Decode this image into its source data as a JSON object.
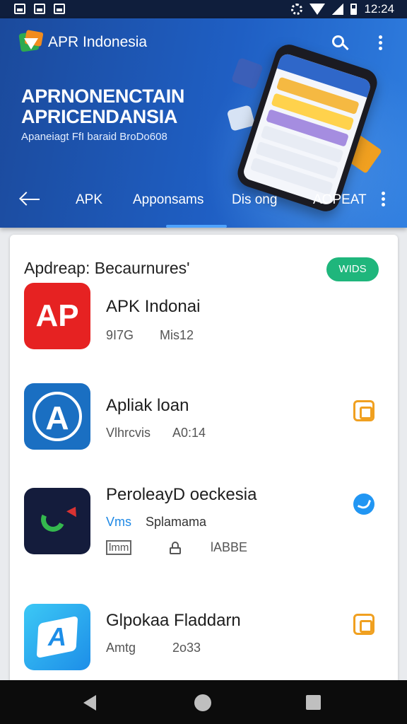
{
  "status_bar": {
    "time": "12:24"
  },
  "header": {
    "app_title": "APR Indonesia",
    "headline_line1": "APRNONENCTAIN",
    "headline_line2": "APRICENDANSIA",
    "subtitle": "Apaneiagt FfI baraid BroDo608"
  },
  "tabs": [
    {
      "label": "APK"
    },
    {
      "label": "Apponsams",
      "active": true
    },
    {
      "label": "Dis ong"
    },
    {
      "label": "AOPEAT"
    }
  ],
  "section": {
    "title": "Apdreap: Becaurnures'",
    "badge": "WIDS"
  },
  "apps": [
    {
      "name": "APK Indonai",
      "meta": [
        "9I7G",
        "Mis12"
      ],
      "icon_text": "AP"
    },
    {
      "name": "Apliak loan",
      "meta": [
        "Vlhrcvis",
        "A0:14"
      ],
      "icon_text": "A"
    },
    {
      "name": "PeroleayD oeckesia",
      "meta_accent": "Vms",
      "meta": [
        "Splamama"
      ],
      "sub_meta": [
        "lmm",
        "lABBE"
      ]
    },
    {
      "name": "Glpokaa Fladdarn",
      "meta": [
        "Amtg",
        "2o33"
      ],
      "icon_text": "A"
    }
  ],
  "colors": {
    "hero": "#1f5fc4",
    "badge": "#1fb67c",
    "accent": "#2196f3",
    "action": "#f0a020"
  },
  "icons": [
    "search-icon",
    "more-vert-icon",
    "back-arrow-icon",
    "copy-icon",
    "messenger-icon",
    "lock-icon",
    "nav-back-icon",
    "nav-home-icon",
    "nav-recent-icon"
  ]
}
